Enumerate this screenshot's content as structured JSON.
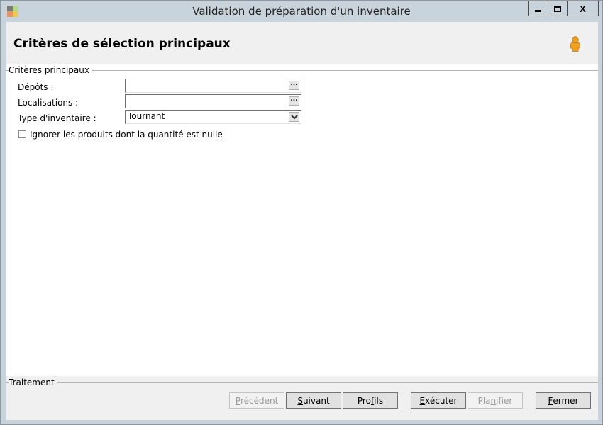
{
  "window": {
    "title": "Validation de préparation d'un inventaire",
    "close_label": "X"
  },
  "header": {
    "title": "Critères de sélection principaux",
    "icon": "user-icon"
  },
  "criteria_group": {
    "legend": "Critères principaux",
    "fields": [
      {
        "label": "Dépôts :",
        "value": "",
        "button": "..."
      },
      {
        "label": "Localisations :",
        "value": "",
        "button": "..."
      },
      {
        "label": "Type d'inventaire :",
        "value": "Tournant"
      }
    ],
    "checkbox": {
      "label": "Ignorer les produits dont la quantité est nulle",
      "checked": false
    }
  },
  "processing_group": {
    "legend": "Traitement"
  },
  "buttons": {
    "previous": {
      "mn": "P",
      "rest": "récédent",
      "disabled": true
    },
    "next": {
      "mn": "S",
      "rest": "uivant",
      "disabled": false
    },
    "profiles": {
      "pre": "Pro",
      "mn": "f",
      "rest": "ils",
      "disabled": false
    },
    "execute": {
      "mn": "E",
      "rest": "xécuter",
      "disabled": false
    },
    "schedule": {
      "pre": "Pla",
      "mn": "n",
      "rest": "ifier",
      "disabled": true
    },
    "close": {
      "mn": "F",
      "rest": "ermer",
      "disabled": false
    }
  },
  "colors": {
    "titlebar": "#c9d3dc",
    "band": "#f0f0f0",
    "user_icon": "#f0a020"
  }
}
